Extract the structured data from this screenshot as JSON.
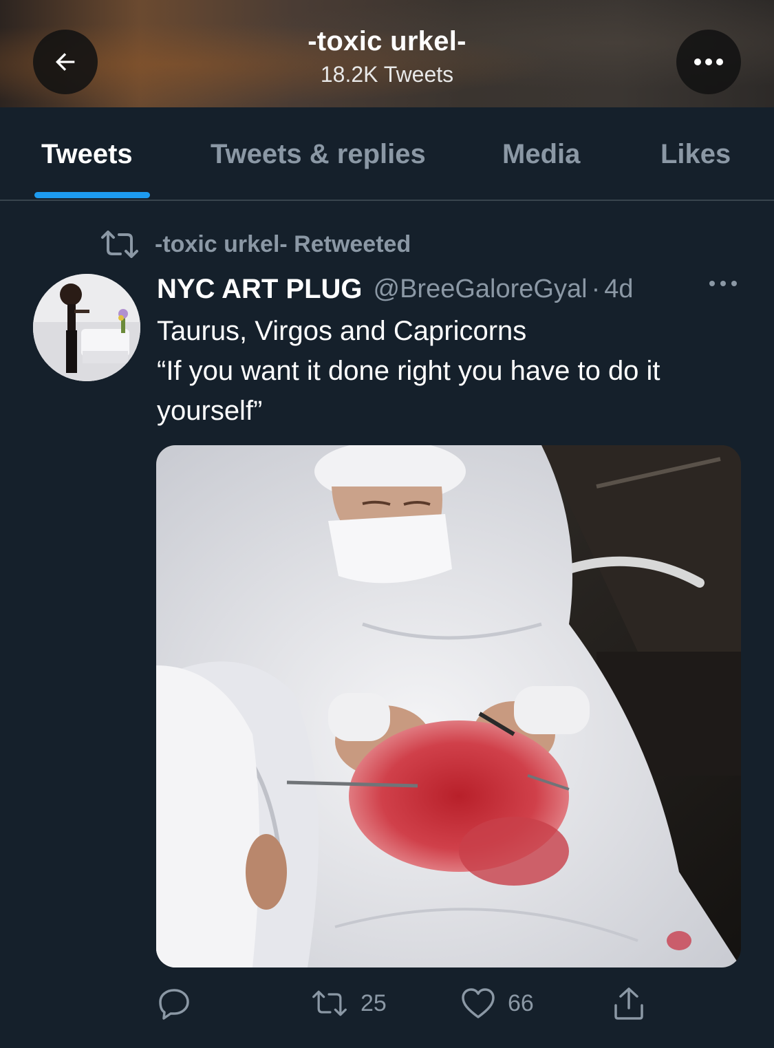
{
  "header": {
    "title": "-toxic urkel-",
    "subtitle": "18.2K Tweets",
    "back_icon": "arrow-left-icon",
    "more_icon": "ellipsis-icon"
  },
  "tabs": [
    {
      "label": "Tweets",
      "active": true
    },
    {
      "label": "Tweets & replies",
      "active": false
    },
    {
      "label": "Media",
      "active": false
    },
    {
      "label": "Likes",
      "active": false
    }
  ],
  "tweet": {
    "retweet_context": "-toxic urkel- Retweeted",
    "author_name": "NYC ART PLUG",
    "author_handle": "@BreeGaloreGyal",
    "separator": "·",
    "time": "4d",
    "text": "Taurus, Virgos and Capricorns\n“If you want it done right you have to do it yourself”",
    "media_icon": "photo",
    "actions": {
      "reply": {
        "icon": "reply-icon",
        "count": ""
      },
      "retweet": {
        "icon": "retweet-icon",
        "count": "25"
      },
      "like": {
        "icon": "heart-icon",
        "count": "66"
      },
      "share": {
        "icon": "share-icon",
        "count": ""
      }
    }
  },
  "colors": {
    "background": "#15202b",
    "secondary_text": "#8b98a5",
    "accent": "#1d9bf0",
    "divider": "#38444d"
  }
}
